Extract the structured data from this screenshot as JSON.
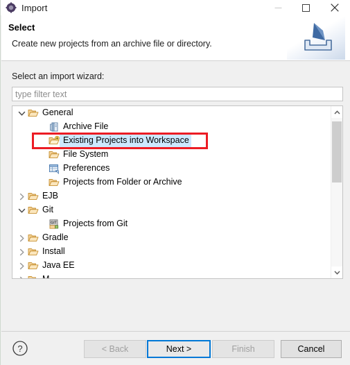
{
  "window": {
    "title": "Import",
    "icon": "import-wizard-icon",
    "controls": {
      "minimize": "minimize-icon",
      "maximize": "maximize-icon",
      "close": "close-icon"
    }
  },
  "header": {
    "title": "Select",
    "description": "Create new projects from an archive file or directory.",
    "graphic": "import-banner-icon"
  },
  "body": {
    "wizard_label": "Select an import wizard:",
    "filter": {
      "value": "",
      "placeholder": "type filter text"
    }
  },
  "tree": {
    "rows": [
      {
        "label": "General",
        "icon": "folder-icon",
        "twisty": "expanded",
        "indent": 1,
        "selected": false
      },
      {
        "label": "Archive File",
        "icon": "archive-file-icon",
        "twisty": "none",
        "indent": 2,
        "selected": false
      },
      {
        "label": "Existing Projects into Workspace",
        "icon": "folder-new-icon",
        "twisty": "none",
        "indent": 2,
        "selected": true
      },
      {
        "label": "File System",
        "icon": "folder-icon",
        "twisty": "none",
        "indent": 2,
        "selected": false
      },
      {
        "label": "Preferences",
        "icon": "preferences-icon",
        "twisty": "none",
        "indent": 2,
        "selected": false
      },
      {
        "label": "Projects from Folder or Archive",
        "icon": "folder-icon",
        "twisty": "none",
        "indent": 2,
        "selected": false
      },
      {
        "label": "EJB",
        "icon": "folder-icon",
        "twisty": "collapsed",
        "indent": 1,
        "selected": false
      },
      {
        "label": "Git",
        "icon": "folder-icon",
        "twisty": "expanded",
        "indent": 1,
        "selected": false
      },
      {
        "label": "Projects from Git",
        "icon": "git-icon",
        "twisty": "none",
        "indent": 2,
        "selected": false
      },
      {
        "label": "Gradle",
        "icon": "folder-icon",
        "twisty": "collapsed",
        "indent": 1,
        "selected": false
      },
      {
        "label": "Install",
        "icon": "folder-icon",
        "twisty": "collapsed",
        "indent": 1,
        "selected": false
      },
      {
        "label": "Java EE",
        "icon": "folder-icon",
        "twisty": "collapsed",
        "indent": 1,
        "selected": false
      },
      {
        "label": "M",
        "icon": "folder-icon",
        "twisty": "collapsed",
        "indent": 1,
        "selected": false
      }
    ],
    "highlight": {
      "target_row_label": "Existing Projects into Workspace",
      "color": "#ec1c24"
    },
    "scrollbar": {
      "up_icon": "chevron-up-icon",
      "down_icon": "chevron-down-icon",
      "thumb_position_pct": 2,
      "thumb_size_pct": 41
    }
  },
  "footer": {
    "help": "help-icon",
    "buttons": [
      {
        "label": "< Back",
        "state": "disabled"
      },
      {
        "label": "Next >",
        "state": "focused"
      },
      {
        "label": "Finish",
        "state": "disabled"
      },
      {
        "label": "Cancel",
        "state": "enabled"
      }
    ]
  },
  "colors": {
    "focus_blue": "#0078d7",
    "selection_blue": "#cde8ff",
    "annotation_red": "#ec1c24",
    "dialog_gray": "#f0f0f0",
    "folder_tan": "#e8b765"
  }
}
